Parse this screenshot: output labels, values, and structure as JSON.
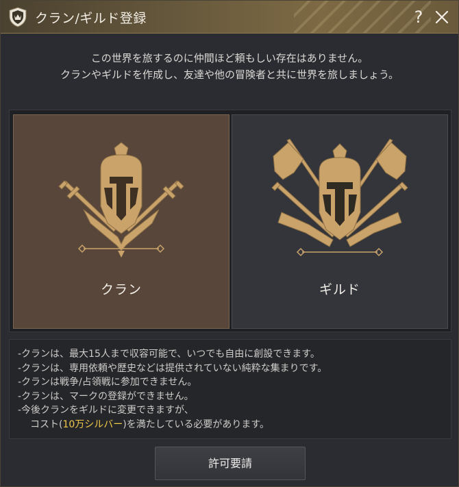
{
  "window": {
    "title": "クラン/ギルド登録",
    "help_label": "?"
  },
  "intro": {
    "line1": "この世界を旅するのに仲間ほど頼もしい存在はありません。",
    "line2": "クランやギルドを作成し、友達や他の冒険者と共に世界を旅しましょう。"
  },
  "choices": [
    {
      "label": "クラン",
      "selected": true
    },
    {
      "label": "ギルド",
      "selected": false
    }
  ],
  "notes": {
    "line1": "-クランは、最大15人まで収容可能で、いつでも自由に創設できます。",
    "line2": "-クランは、専用依頼や歴史などは提供されていない純粋な集まりです。",
    "line3": "-クランは戦争/占領戦に参加できません。",
    "line4": "-クランは、マークの登録ができません。",
    "line5": "-今後クランをギルドに変更できますが、",
    "line6_prefix": "コスト(",
    "line6_highlight": "10万シルバー",
    "line6_suffix": ")を満たしている必要があります。"
  },
  "actions": {
    "request_label": "許可要請"
  },
  "colors": {
    "accent_gold": "#c9a36a",
    "highlight": "#f2c94a",
    "selected_card": "#58463a"
  }
}
